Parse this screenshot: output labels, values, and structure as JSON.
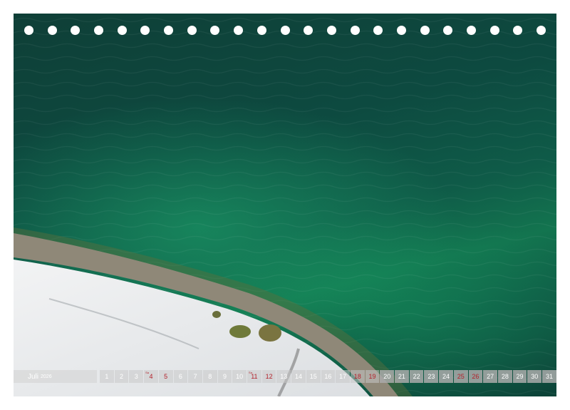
{
  "calendar": {
    "month_label": "Juli",
    "year_label": "2026",
    "days": [
      {
        "label": "1",
        "red": false,
        "solid": false,
        "note": ""
      },
      {
        "label": "2",
        "red": false,
        "solid": false,
        "note": ""
      },
      {
        "label": "3",
        "red": false,
        "solid": false,
        "note": ""
      },
      {
        "label": "4",
        "red": true,
        "solid": false,
        "note": "Sa"
      },
      {
        "label": "5",
        "red": true,
        "solid": false,
        "note": ""
      },
      {
        "label": "6",
        "red": false,
        "solid": false,
        "note": ""
      },
      {
        "label": "7",
        "red": false,
        "solid": false,
        "note": ""
      },
      {
        "label": "8",
        "red": false,
        "solid": false,
        "note": ""
      },
      {
        "label": "9",
        "red": false,
        "solid": false,
        "note": ""
      },
      {
        "label": "10",
        "red": false,
        "solid": false,
        "note": ""
      },
      {
        "label": "11",
        "red": true,
        "solid": false,
        "note": "Sa"
      },
      {
        "label": "12",
        "red": true,
        "solid": false,
        "note": ""
      },
      {
        "label": "13",
        "red": false,
        "solid": false,
        "note": ""
      },
      {
        "label": "14",
        "red": false,
        "solid": false,
        "note": ""
      },
      {
        "label": "15",
        "red": false,
        "solid": false,
        "note": ""
      },
      {
        "label": "16",
        "red": false,
        "solid": false,
        "note": ""
      },
      {
        "label": "17",
        "red": false,
        "solid": false,
        "note": ""
      },
      {
        "label": "18",
        "red": true,
        "solid": false,
        "note": ""
      },
      {
        "label": "19",
        "red": true,
        "solid": false,
        "note": ""
      },
      {
        "label": "20",
        "red": false,
        "solid": true,
        "note": ""
      },
      {
        "label": "21",
        "red": false,
        "solid": true,
        "note": ""
      },
      {
        "label": "22",
        "red": false,
        "solid": true,
        "note": ""
      },
      {
        "label": "23",
        "red": false,
        "solid": true,
        "note": ""
      },
      {
        "label": "24",
        "red": false,
        "solid": true,
        "note": ""
      },
      {
        "label": "25",
        "red": true,
        "solid": true,
        "note": ""
      },
      {
        "label": "26",
        "red": true,
        "solid": true,
        "note": ""
      },
      {
        "label": "27",
        "red": false,
        "solid": true,
        "note": ""
      },
      {
        "label": "28",
        "red": false,
        "solid": true,
        "note": ""
      },
      {
        "label": "29",
        "red": false,
        "solid": true,
        "note": ""
      },
      {
        "label": "30",
        "red": false,
        "solid": true,
        "note": ""
      },
      {
        "label": "31",
        "red": false,
        "solid": true,
        "note": ""
      }
    ]
  },
  "binding": {
    "hole_count": 23
  },
  "colors": {
    "water_dark": "#0d4a40",
    "water_shallow": "#13744f",
    "snow": "#e8eaec",
    "weekend_red": "#b3202a"
  }
}
